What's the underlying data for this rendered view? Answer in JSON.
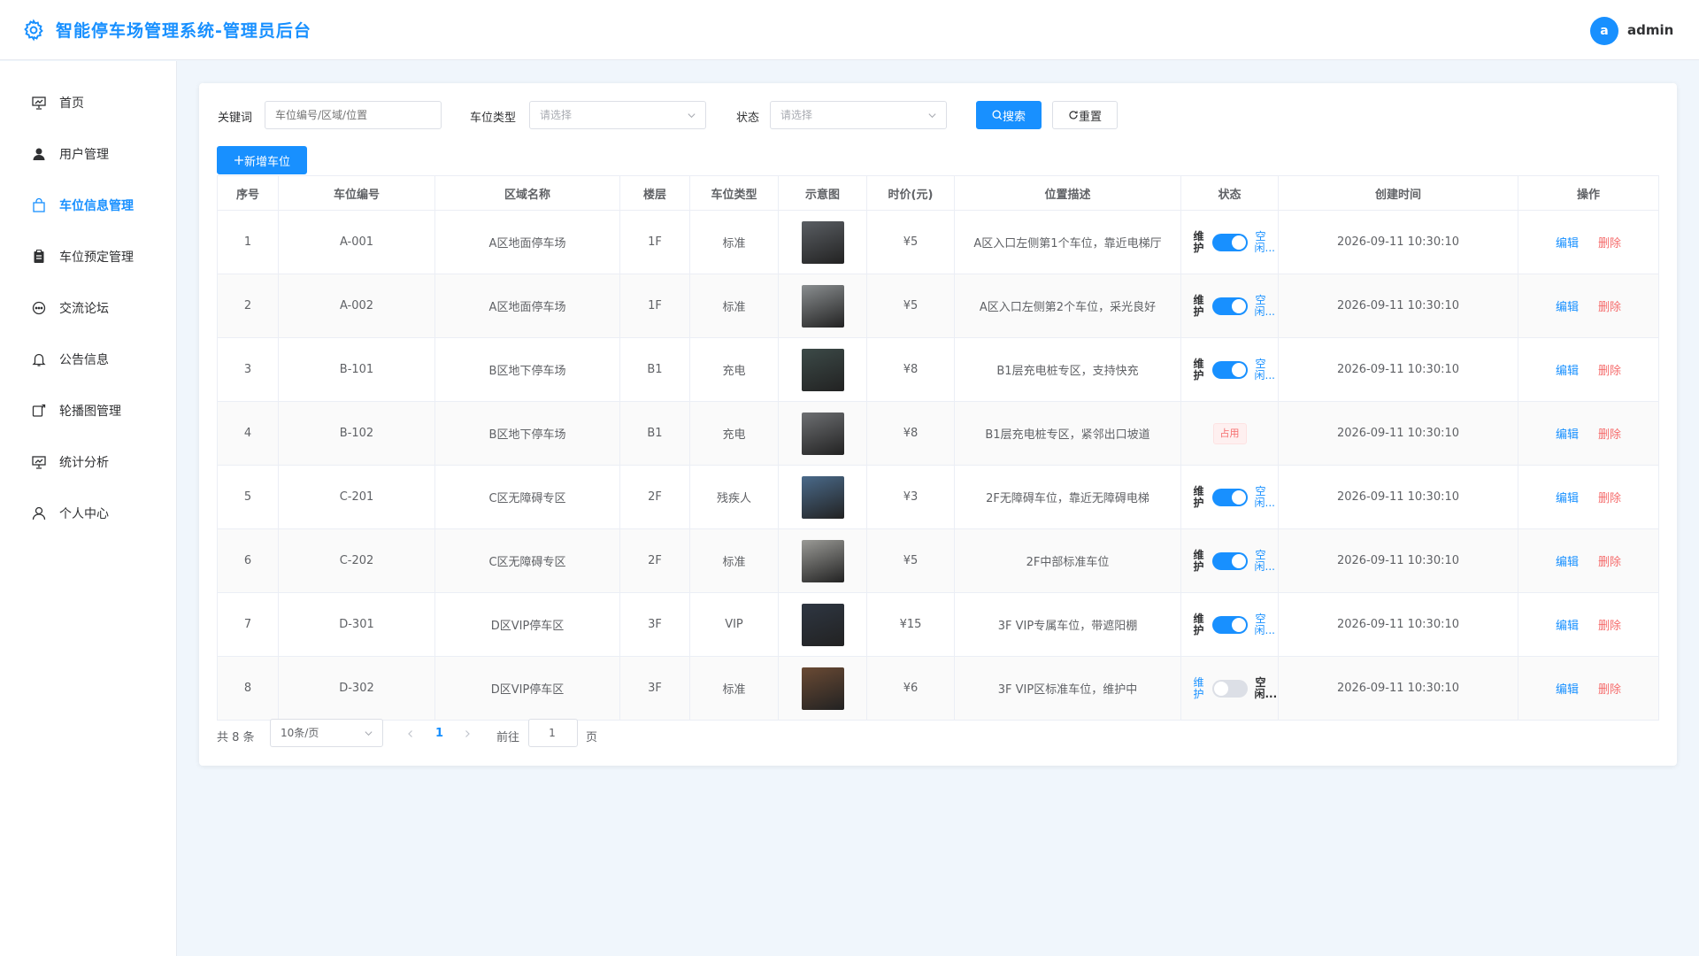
{
  "app": {
    "title": "智能停车场管理系统-管理员后台",
    "user_avatar": "a",
    "username": "admin",
    "accent": "#1890ff"
  },
  "sidebar": {
    "items": [
      {
        "label": "首页",
        "icon": "chart-board-icon",
        "active": false
      },
      {
        "label": "用户管理",
        "icon": "user-filled-icon",
        "active": false
      },
      {
        "label": "车位信息管理",
        "icon": "bag-icon",
        "active": true
      },
      {
        "label": "车位预定管理",
        "icon": "clipboard-icon",
        "active": false
      },
      {
        "label": "交流论坛",
        "icon": "chat-bubble-icon",
        "active": false
      },
      {
        "label": "公告信息",
        "icon": "bell-icon",
        "active": false
      },
      {
        "label": "轮播图管理",
        "icon": "carousel-icon",
        "active": false
      },
      {
        "label": "统计分析",
        "icon": "chart-board-icon",
        "active": false
      },
      {
        "label": "个人中心",
        "icon": "user-outline-icon",
        "active": false
      }
    ]
  },
  "filters": {
    "keyword_label": "关键词",
    "keyword_placeholder": "车位编号/区域/位置",
    "type_label": "车位类型",
    "type_placeholder": "请选择",
    "status_label": "状态",
    "status_placeholder": "请选择",
    "search_button": "搜索",
    "reset_button": "重置",
    "add_button": "新增车位"
  },
  "table": {
    "columns": [
      "序号",
      "车位编号",
      "区域名称",
      "楼层",
      "车位类型",
      "示意图",
      "时价(元)",
      "位置描述",
      "状态",
      "创建时间",
      "操作"
    ],
    "status_left": "维护",
    "status_right": "空闲...",
    "occupied_tag": "占用",
    "edit_label": "编辑",
    "delete_label": "删除",
    "rows": [
      {
        "no": "1",
        "code": "A-001",
        "area": "A区地面停车场",
        "floor": "1F",
        "type": "标准",
        "thumb": "#5a5e63",
        "price": "¥5",
        "desc": "A区入口左侧第1个车位，靠近电梯厅",
        "status": "on",
        "created": "2026-09-11 10:30:10"
      },
      {
        "no": "2",
        "code": "A-002",
        "area": "A区地面停车场",
        "floor": "1F",
        "type": "标准",
        "thumb": "#8a8e90",
        "price": "¥5",
        "desc": "A区入口左侧第2个车位，采光良好",
        "status": "on",
        "created": "2026-09-11 10:30:10"
      },
      {
        "no": "3",
        "code": "B-101",
        "area": "B区地下停车场",
        "floor": "B1",
        "type": "充电",
        "thumb": "#3c4a48",
        "price": "¥8",
        "desc": "B1层充电桩专区，支持快充",
        "status": "on",
        "created": "2026-09-11 10:30:10"
      },
      {
        "no": "4",
        "code": "B-102",
        "area": "B区地下停车场",
        "floor": "B1",
        "type": "充电",
        "thumb": "#6d6f72",
        "price": "¥8",
        "desc": "B1层充电桩专区，紧邻出口坡道",
        "status": "occupied",
        "created": "2026-09-11 10:30:10"
      },
      {
        "no": "5",
        "code": "C-201",
        "area": "C区无障碍专区",
        "floor": "2F",
        "type": "残疾人",
        "thumb": "#4a6a8a",
        "price": "¥3",
        "desc": "2F无障碍车位，靠近无障碍电梯",
        "status": "on",
        "created": "2026-09-11 10:30:10"
      },
      {
        "no": "6",
        "code": "C-202",
        "area": "C区无障碍专区",
        "floor": "2F",
        "type": "标准",
        "thumb": "#9a9a96",
        "price": "¥5",
        "desc": "2F中部标准车位",
        "status": "on",
        "created": "2026-09-11 10:30:10"
      },
      {
        "no": "7",
        "code": "D-301",
        "area": "D区VIP停车区",
        "floor": "3F",
        "type": "VIP",
        "thumb": "#2e3642",
        "price": "¥15",
        "desc": "3F VIP专属车位，带遮阳棚",
        "status": "on",
        "created": "2026-09-11 10:30:10"
      },
      {
        "no": "8",
        "code": "D-302",
        "area": "D区VIP停车区",
        "floor": "3F",
        "type": "标准",
        "thumb": "#6a4a34",
        "price": "¥6",
        "desc": "3F VIP区标准车位，维护中",
        "status": "off",
        "created": "2026-09-11 10:30:10"
      }
    ]
  },
  "pager": {
    "total": "共 8 条",
    "page_size": "10条/页",
    "current_page": "1",
    "goto_label": "前往",
    "goto_value": "1",
    "page_unit": "页"
  }
}
